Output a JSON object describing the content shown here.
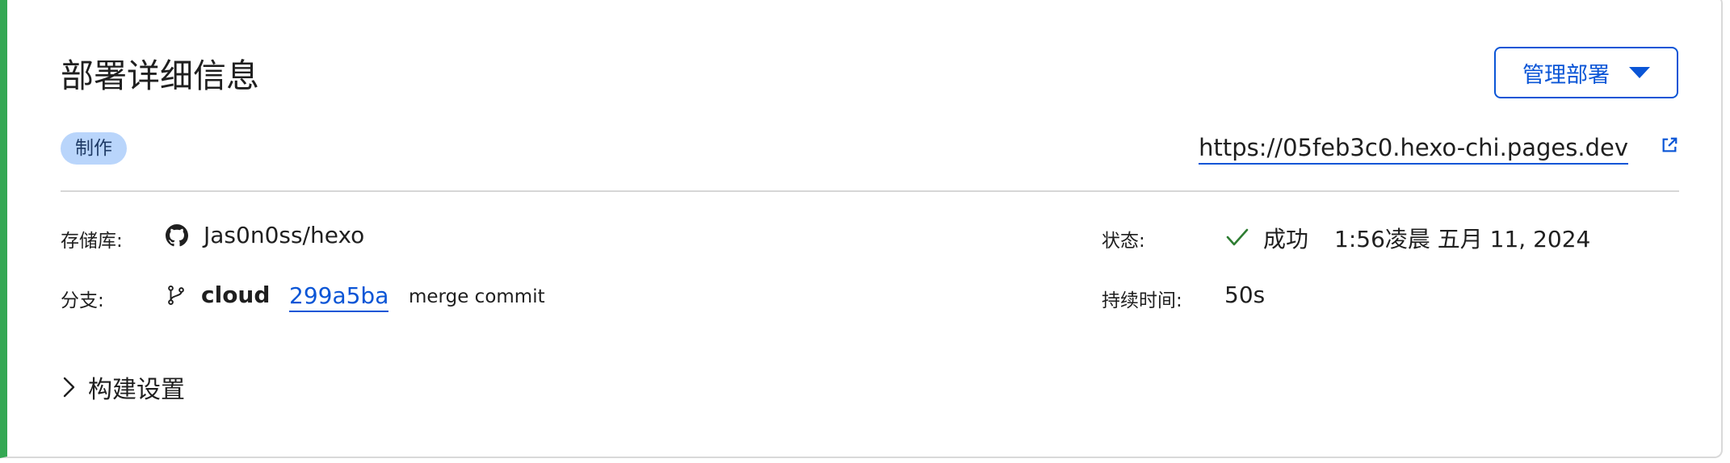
{
  "header": {
    "title": "部署详细信息",
    "manage_button_label": "管理部署"
  },
  "environment_badge": "制作",
  "deployment_url": "https://05feb3c0.hexo-chi.pages.dev",
  "details": {
    "repository_label": "存储库:",
    "repository_value": "Jas0n0ss/hexo",
    "branch_label": "分支:",
    "branch_value": "cloud",
    "commit_hash": "299a5ba",
    "commit_message": "merge commit",
    "status_label": "状态:",
    "status_value": "成功",
    "status_time": "1:56凌晨 五月 11, 2024",
    "duration_label": "持续时间:",
    "duration_value": "50s"
  },
  "build_settings_label": "构建设置",
  "colors": {
    "accent": "#0a55d6",
    "success": "#34a853",
    "badge_bg": "#b9d5fb"
  },
  "icons": [
    "github-icon",
    "git-branch-icon",
    "checkmark-icon",
    "external-link-icon",
    "chevron-right-icon",
    "caret-down-icon"
  ]
}
